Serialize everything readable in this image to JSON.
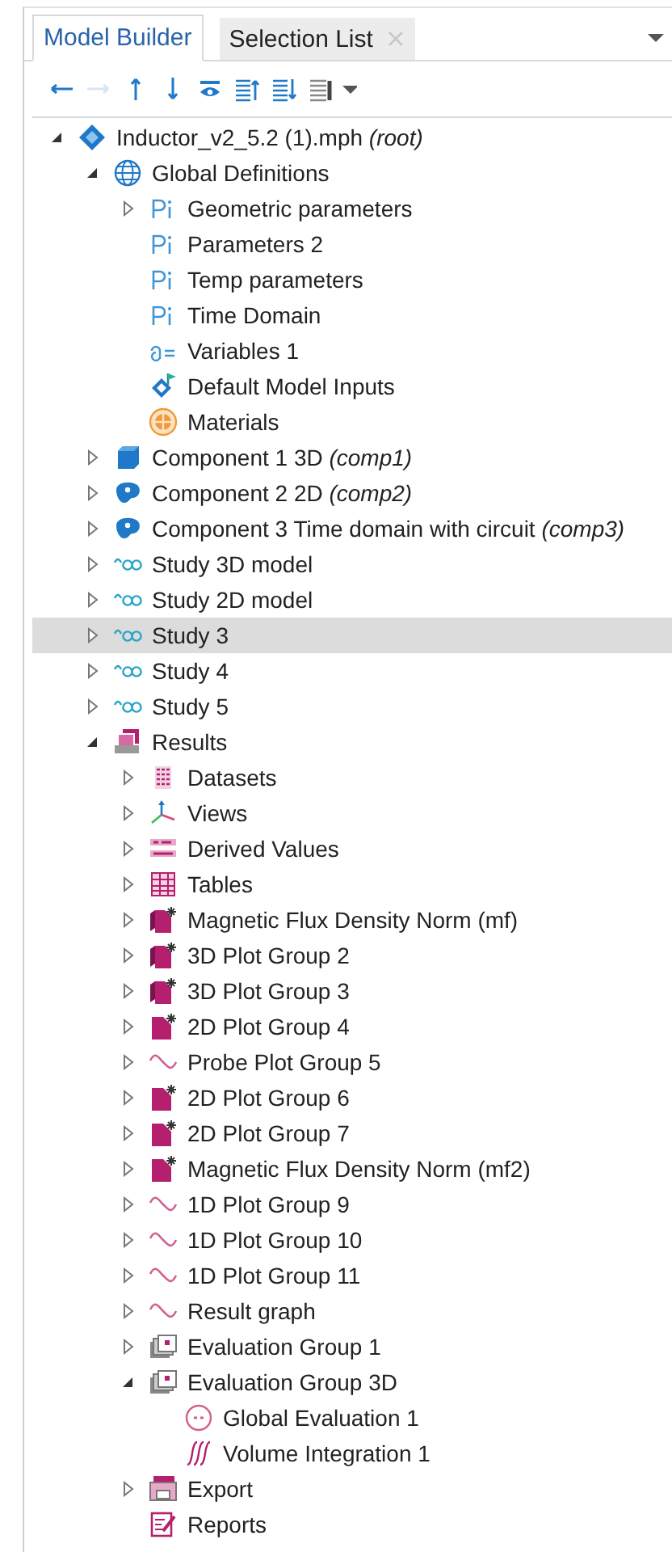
{
  "tabs": [
    {
      "label": "Model Builder",
      "selected": true,
      "closable": false
    },
    {
      "label": "Selection List",
      "selected": false,
      "closable": true
    }
  ],
  "tab_menu": {
    "kind": "caret"
  },
  "toolbar": [
    {
      "kind": "back",
      "disabled": false
    },
    {
      "kind": "forward",
      "disabled": true
    },
    {
      "kind": "up",
      "disabled": false
    },
    {
      "kind": "down",
      "disabled": false
    },
    {
      "kind": "eye",
      "disabled": false
    },
    {
      "kind": "collapse",
      "disabled": false
    },
    {
      "kind": "expand",
      "disabled": false
    },
    {
      "kind": "list",
      "disabled": false
    },
    {
      "kind": "caret",
      "disabled": false
    }
  ],
  "tree": [
    {
      "label": "Inductor_v2_5.2 (1).mph *(root)*",
      "kind": "model",
      "expanded": true,
      "selected": false,
      "children": [
        {
          "label": "Global Definitions",
          "kind": "globe",
          "expanded": true,
          "selected": false,
          "children": [
            {
              "label": "Geometric parameters",
              "kind": "param",
              "expanded": false,
              "selected": false
            },
            {
              "label": "Parameters 2",
              "kind": "param",
              "selected": false
            },
            {
              "label": "Temp parameters",
              "kind": "param",
              "selected": false
            },
            {
              "label": "Time Domain",
              "kind": "param",
              "selected": false
            },
            {
              "label": "Variables 1",
              "kind": "variables",
              "selected": false
            },
            {
              "label": "Default Model Inputs",
              "kind": "inputs",
              "selected": false
            },
            {
              "label": "Materials",
              "kind": "materials",
              "selected": false
            }
          ]
        },
        {
          "label": "Component 1 3D *(comp1)*",
          "kind": "comp3d",
          "expanded": false,
          "selected": false
        },
        {
          "label": "Component 2 2D *(comp2)*",
          "kind": "comp2d",
          "expanded": false,
          "selected": false
        },
        {
          "label": "Component 3 Time domain with circuit *(comp3)*",
          "kind": "comp2d",
          "expanded": false,
          "selected": false
        },
        {
          "label": "Study 3D model",
          "kind": "study",
          "expanded": false,
          "selected": false
        },
        {
          "label": "Study 2D model",
          "kind": "study",
          "expanded": false,
          "selected": false
        },
        {
          "label": "Study 3",
          "kind": "study",
          "expanded": false,
          "selected": true
        },
        {
          "label": "Study 4",
          "kind": "study",
          "expanded": false,
          "selected": false
        },
        {
          "label": "Study 5",
          "kind": "study",
          "expanded": false,
          "selected": false
        },
        {
          "label": "Results",
          "kind": "results",
          "expanded": true,
          "selected": false,
          "children": [
            {
              "label": "Datasets",
              "kind": "datasets",
              "expanded": false,
              "selected": false
            },
            {
              "label": "Views",
              "kind": "views",
              "expanded": false,
              "selected": false
            },
            {
              "label": "Derived Values",
              "kind": "derived",
              "expanded": false,
              "selected": false
            },
            {
              "label": "Tables",
              "kind": "tables",
              "expanded": false,
              "selected": false
            },
            {
              "label": "Magnetic Flux Density Norm (mf)",
              "kind": "plot3d",
              "expanded": false,
              "selected": false
            },
            {
              "label": "3D Plot Group 2",
              "kind": "plot3d",
              "expanded": false,
              "selected": false
            },
            {
              "label": "3D Plot Group 3",
              "kind": "plot3d",
              "expanded": false,
              "selected": false
            },
            {
              "label": "2D Plot Group 4",
              "kind": "plot2d",
              "expanded": false,
              "selected": false
            },
            {
              "label": "Probe Plot Group 5",
              "kind": "plot1d",
              "expanded": false,
              "selected": false
            },
            {
              "label": "2D Plot Group 6",
              "kind": "plot2d",
              "expanded": false,
              "selected": false
            },
            {
              "label": "2D Plot Group 7",
              "kind": "plot2d",
              "expanded": false,
              "selected": false
            },
            {
              "label": "Magnetic Flux Density Norm (mf2)",
              "kind": "plot2d",
              "expanded": false,
              "selected": false
            },
            {
              "label": "1D Plot Group 9",
              "kind": "plot1d",
              "expanded": false,
              "selected": false
            },
            {
              "label": "1D Plot Group 10",
              "kind": "plot1d",
              "expanded": false,
              "selected": false
            },
            {
              "label": "1D Plot Group 11",
              "kind": "plot1d",
              "expanded": false,
              "selected": false
            },
            {
              "label": "Result graph",
              "kind": "plot1d",
              "expanded": false,
              "selected": false
            },
            {
              "label": "Evaluation Group 1",
              "kind": "evalgroup",
              "expanded": false,
              "selected": false
            },
            {
              "label": "Evaluation Group 3D",
              "kind": "evalgroup",
              "expanded": true,
              "selected": false,
              "children": [
                {
                  "label": "Global Evaluation 1",
                  "kind": "globaleval",
                  "selected": false
                },
                {
                  "label": "Volume Integration 1",
                  "kind": "integration",
                  "selected": false
                }
              ]
            },
            {
              "label": "Export",
              "kind": "export",
              "expanded": false,
              "selected": false
            },
            {
              "label": "Reports",
              "kind": "reports",
              "selected": false
            }
          ]
        }
      ]
    }
  ]
}
